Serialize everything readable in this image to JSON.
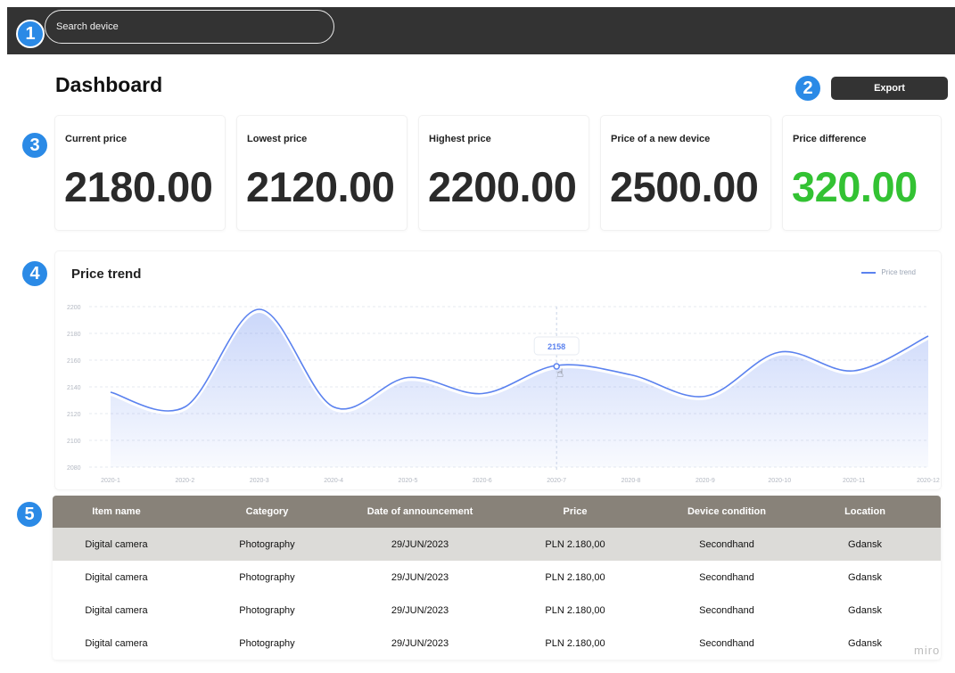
{
  "search": {
    "placeholder": "Search device"
  },
  "header": {
    "title": "Dashboard",
    "export_label": "Export"
  },
  "badges": [
    "1",
    "2",
    "3",
    "4",
    "5"
  ],
  "stats": [
    {
      "label": "Current price",
      "value": "2180.00"
    },
    {
      "label": "Lowest price",
      "value": "2120.00"
    },
    {
      "label": "Highest price",
      "value": "2200.00"
    },
    {
      "label": "Price of a new device",
      "value": "2500.00"
    },
    {
      "label": "Price difference",
      "value": "320.00"
    }
  ],
  "colors": {
    "accent": "#5b82ef",
    "positive": "#33c233",
    "header_bar": "#333333",
    "table_header": "#888279",
    "badge": "#2b8ae6"
  },
  "chart_data": {
    "type": "area",
    "title": "Price trend",
    "legend": [
      "Price trend"
    ],
    "legend_position": "top-right",
    "grid": true,
    "x": [
      "2020-1",
      "2020-2",
      "2020-3",
      "2020-4",
      "2020-5",
      "2020-6",
      "2020-7",
      "2020-8",
      "2020-9",
      "2020-10",
      "2020-11",
      "2020-12"
    ],
    "series": [
      {
        "name": "Price trend",
        "values": [
          2136,
          2125,
          2198,
          2125,
          2147,
          2135,
          2156,
          2149,
          2133,
          2166,
          2152,
          2178
        ]
      }
    ],
    "yticks": [
      "2080",
      "2100",
      "2120",
      "2140",
      "2160",
      "2180",
      "2200"
    ],
    "ylim": [
      2080,
      2200
    ],
    "tooltip": {
      "x": "2020-7",
      "value": "2158"
    }
  },
  "table": {
    "headers": [
      "Item name",
      "Category",
      "Date of announcement",
      "Price",
      "Device condition",
      "Location"
    ],
    "rows": [
      [
        "Digital camera",
        "Photography",
        "29/JUN/2023",
        "PLN 2.180,00",
        "Secondhand",
        "Gdansk"
      ],
      [
        "Digital camera",
        "Photography",
        "29/JUN/2023",
        "PLN 2.180,00",
        "Secondhand",
        "Gdansk"
      ],
      [
        "Digital camera",
        "Photography",
        "29/JUN/2023",
        "PLN 2.180,00",
        "Secondhand",
        "Gdansk"
      ],
      [
        "Digital camera",
        "Photography",
        "29/JUN/2023",
        "PLN 2.180,00",
        "Secondhand",
        "Gdansk"
      ]
    ],
    "selected_row": 0
  },
  "watermark": "miro"
}
